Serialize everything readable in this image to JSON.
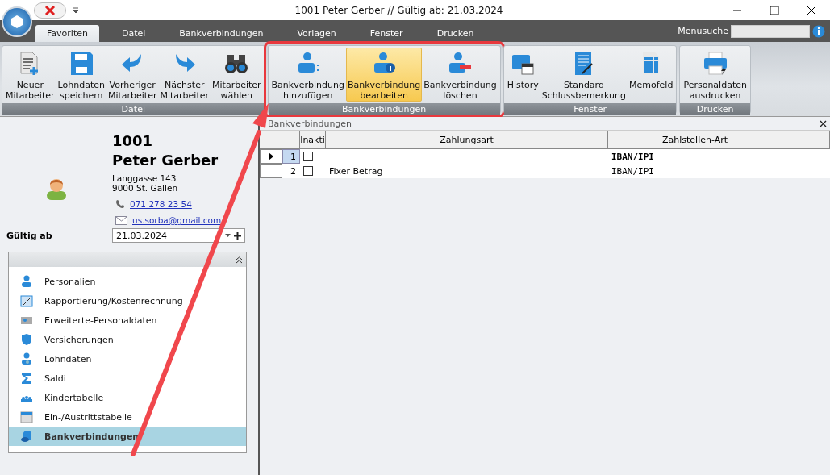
{
  "window": {
    "title": "1001 Peter Gerber // Gültig ab: 21.03.2024"
  },
  "tabs": [
    {
      "label": "Favoriten",
      "selected": true
    },
    {
      "label": "Datei",
      "selected": false
    },
    {
      "label": "Bankverbindungen",
      "selected": false
    },
    {
      "label": "Vorlagen",
      "selected": false
    },
    {
      "label": "Fenster",
      "selected": false
    },
    {
      "label": "Drucken",
      "selected": false
    }
  ],
  "menu_search": {
    "label": "Menusuche"
  },
  "ribbon_groups": [
    {
      "title": "Datei",
      "highlighted": false,
      "buttons": [
        {
          "label": "Neuer\nMitarbeiter",
          "selected": false
        },
        {
          "label": "Lohndaten\nspeichern",
          "selected": false
        },
        {
          "label": "Vorheriger\nMitarbeiter",
          "selected": false
        },
        {
          "label": "Nächster\nMitarbeiter",
          "selected": false
        },
        {
          "label": "Mitarbeiter\nwählen",
          "selected": false
        }
      ]
    },
    {
      "title": "Bankverbindungen",
      "highlighted": true,
      "buttons": [
        {
          "label": "Bankverbindung\nhinzufügen",
          "selected": false
        },
        {
          "label": "Bankverbindung\nbearbeiten",
          "selected": true
        },
        {
          "label": "Bankverbindung\nlöschen",
          "selected": false
        }
      ]
    },
    {
      "title": "Fenster",
      "highlighted": false,
      "buttons": [
        {
          "label": "History",
          "selected": false
        },
        {
          "label": "Standard\nSchlussbemerkung",
          "selected": false
        },
        {
          "label": "Memofeld",
          "selected": false
        }
      ]
    },
    {
      "title": "Drucken",
      "highlighted": false,
      "buttons": [
        {
          "label": "Personaldaten\nausdrucken",
          "selected": false
        }
      ]
    }
  ],
  "employee": {
    "number": "1001",
    "name": "Peter Gerber",
    "street": "Langgasse 143",
    "city": "9000 St. Gallen",
    "phone": "071 278 23 54",
    "email": "us.sorba@gmail.com"
  },
  "valid_from": {
    "label": "Gültig ab",
    "value": "21.03.2024"
  },
  "nav_items": [
    {
      "label": "Personalien",
      "selected": false
    },
    {
      "label": "Rapportierung/Kostenrechnung",
      "selected": false
    },
    {
      "label": "Erweiterte-Personaldaten",
      "selected": false
    },
    {
      "label": "Versicherungen",
      "selected": false
    },
    {
      "label": "Lohndaten",
      "selected": false
    },
    {
      "label": "Saldi",
      "selected": false
    },
    {
      "label": "Kindertabelle",
      "selected": false
    },
    {
      "label": "Ein-/Austrittstabelle",
      "selected": false
    },
    {
      "label": "Bankverbindungen",
      "selected": true
    }
  ],
  "grid": {
    "title": "Bankverbindungen",
    "columns": [
      "Inakti",
      "Zahlungsart",
      "Zahlstellen-Art"
    ],
    "rows": [
      {
        "number": "1",
        "inactive": false,
        "zahlstellen_art": "IBAN/IPI",
        "selected": true
      },
      {
        "number": "2",
        "inactive": false,
        "zahlungsart": "Fixer Betrag",
        "zahlstellen_art": "IBAN/IPI",
        "selected": false
      }
    ]
  }
}
